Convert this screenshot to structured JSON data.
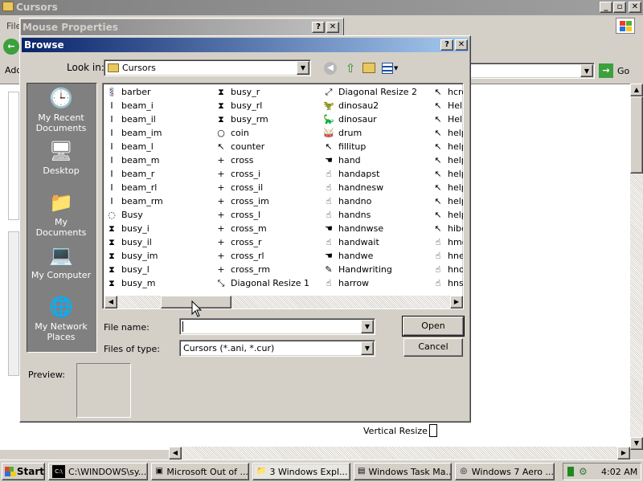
{
  "explorer": {
    "title": "Cursors",
    "menu_fragment": "File",
    "address_fragment": "Addr",
    "go_label": "Go",
    "status_fragment": "Vertical Resize"
  },
  "mouse_props": {
    "title": "Mouse Properties"
  },
  "browse": {
    "title": "Browse",
    "look_in_label": "Look in:",
    "look_in_value": "Cursors",
    "places": [
      {
        "label": "My Recent Documents",
        "icon": "recent-documents-icon",
        "glyph": "🕒"
      },
      {
        "label": "Desktop",
        "icon": "desktop-icon",
        "glyph": "🖥"
      },
      {
        "label": "My Documents",
        "icon": "my-documents-icon",
        "glyph": "📁"
      },
      {
        "label": "My Computer",
        "icon": "my-computer-icon",
        "glyph": "💻"
      },
      {
        "label": "My Network Places",
        "icon": "network-places-icon",
        "glyph": "🌐"
      }
    ],
    "files": [
      [
        {
          "name": "barber",
          "glyph": "💈"
        },
        {
          "name": "beam_i",
          "glyph": "I"
        },
        {
          "name": "beam_il",
          "glyph": "I"
        },
        {
          "name": "beam_im",
          "glyph": "I"
        },
        {
          "name": "beam_l",
          "glyph": "I"
        },
        {
          "name": "beam_m",
          "glyph": "I"
        },
        {
          "name": "beam_r",
          "glyph": "I"
        },
        {
          "name": "beam_rl",
          "glyph": "I"
        },
        {
          "name": "beam_rm",
          "glyph": "I"
        },
        {
          "name": "Busy",
          "glyph": "◌"
        },
        {
          "name": "busy_i",
          "glyph": "⧗"
        },
        {
          "name": "busy_il",
          "glyph": "⧗"
        },
        {
          "name": "busy_im",
          "glyph": "⧗"
        },
        {
          "name": "busy_l",
          "glyph": "⧗"
        },
        {
          "name": "busy_m",
          "glyph": "⧗"
        }
      ],
      [
        {
          "name": "busy_r",
          "glyph": "⧗"
        },
        {
          "name": "busy_rl",
          "glyph": "⧗"
        },
        {
          "name": "busy_rm",
          "glyph": "⧗"
        },
        {
          "name": "coin",
          "glyph": "○"
        },
        {
          "name": "counter",
          "glyph": "↖"
        },
        {
          "name": "cross",
          "glyph": "+"
        },
        {
          "name": "cross_i",
          "glyph": "+"
        },
        {
          "name": "cross_il",
          "glyph": "+"
        },
        {
          "name": "cross_im",
          "glyph": "+"
        },
        {
          "name": "cross_l",
          "glyph": "+"
        },
        {
          "name": "cross_m",
          "glyph": "+"
        },
        {
          "name": "cross_r",
          "glyph": "+"
        },
        {
          "name": "cross_rl",
          "glyph": "+"
        },
        {
          "name": "cross_rm",
          "glyph": "+"
        },
        {
          "name": "Diagonal Resize 1",
          "glyph": "⤡"
        }
      ],
      [
        {
          "name": "Diagonal Resize 2",
          "glyph": "⤢"
        },
        {
          "name": "dinosau2",
          "glyph": "🦖"
        },
        {
          "name": "dinosaur",
          "glyph": "🦕"
        },
        {
          "name": "drum",
          "glyph": "🥁"
        },
        {
          "name": "fillitup",
          "glyph": "↖"
        },
        {
          "name": "hand",
          "glyph": "☚"
        },
        {
          "name": "handapst",
          "glyph": "☝"
        },
        {
          "name": "handnesw",
          "glyph": "☝"
        },
        {
          "name": "handno",
          "glyph": "☝"
        },
        {
          "name": "handns",
          "glyph": "☝"
        },
        {
          "name": "handnwse",
          "glyph": "☚"
        },
        {
          "name": "handwait",
          "glyph": "☝"
        },
        {
          "name": "handwe",
          "glyph": "☚"
        },
        {
          "name": "Handwriting",
          "glyph": "✎"
        },
        {
          "name": "harrow",
          "glyph": "☝"
        }
      ],
      [
        {
          "name": "hcro",
          "glyph": "↖"
        },
        {
          "name": "Help",
          "glyph": "↖"
        },
        {
          "name": "Help",
          "glyph": "↖"
        },
        {
          "name": "help",
          "glyph": "↖"
        },
        {
          "name": "help",
          "glyph": "↖"
        },
        {
          "name": "help",
          "glyph": "↖"
        },
        {
          "name": "help",
          "glyph": "↖"
        },
        {
          "name": "help",
          "glyph": "↖"
        },
        {
          "name": "help",
          "glyph": "↖"
        },
        {
          "name": "help",
          "glyph": "↖"
        },
        {
          "name": "hibe",
          "glyph": "↖"
        },
        {
          "name": "hmo",
          "glyph": "☝"
        },
        {
          "name": "hne",
          "glyph": "☝"
        },
        {
          "name": "hno",
          "glyph": "☝"
        },
        {
          "name": "hns",
          "glyph": "☝"
        }
      ]
    ],
    "file_name_label": "File name:",
    "file_name_value": "",
    "files_of_type_label": "Files of type:",
    "files_of_type_value": "Cursors (*.ani, *.cur)",
    "open_label": "Open",
    "cancel_label": "Cancel",
    "preview_label": "Preview:"
  },
  "taskbar": {
    "start_label": "Start",
    "tasks": [
      {
        "label": "C:\\WINDOWS\\sy...",
        "icon": "console-icon",
        "glyph": "C:\\"
      },
      {
        "label": "Microsoft Out of ...",
        "icon": "program-icon",
        "glyph": "▣"
      },
      {
        "label": "3 Windows Expl...",
        "icon": "folder-icon",
        "glyph": "📁"
      },
      {
        "label": "Windows Task Ma...",
        "icon": "task-manager-icon",
        "glyph": "▤"
      },
      {
        "label": "Windows 7 Aero ...",
        "icon": "browser-icon",
        "glyph": "◎"
      }
    ],
    "clock": "4:02 AM"
  }
}
